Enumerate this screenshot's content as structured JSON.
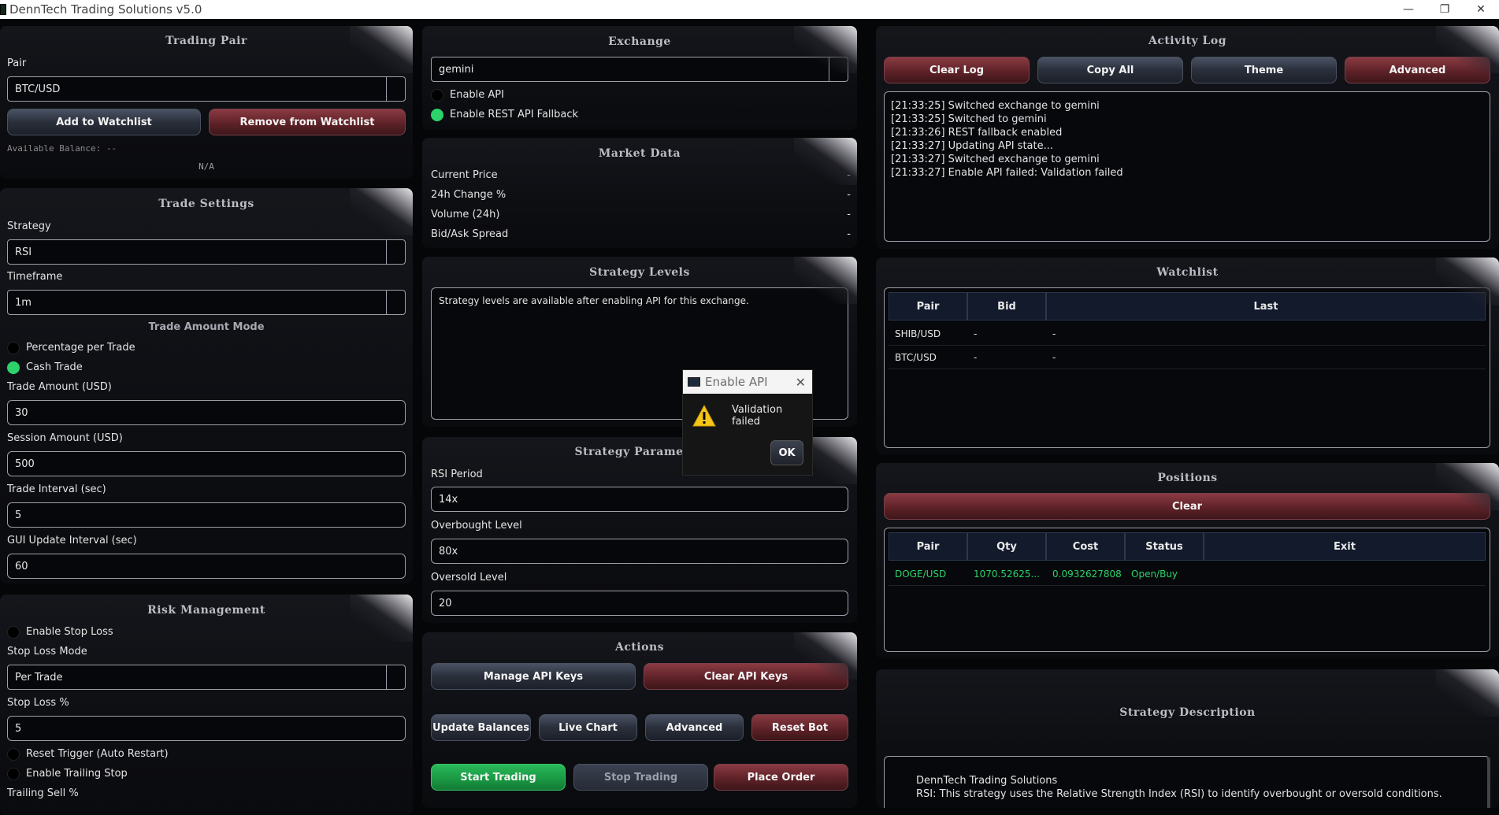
{
  "window": {
    "title": "DennTech Trading Solutions v5.0",
    "minimize": "—",
    "restore": "❐",
    "close": "✕"
  },
  "trading_pair": {
    "title": "Trading Pair",
    "pair_label": "Pair",
    "pair_value": "BTC/USD",
    "add_btn": "Add to Watchlist",
    "remove_btn": "Remove from Watchlist",
    "balance": "Available Balance: --",
    "balance_sub": "N/A"
  },
  "trade_settings": {
    "title": "Trade Settings",
    "strategy_label": "Strategy",
    "strategy_value": "RSI",
    "timeframe_label": "Timeframe",
    "timeframe_value": "1m",
    "mode_title": "Trade Amount Mode",
    "pct_label": "Percentage per Trade",
    "cash_label": "Cash Trade",
    "amount_label": "Trade Amount (USD)",
    "amount_value": "30",
    "session_label": "Session Amount (USD)",
    "session_value": "500",
    "interval_label": "Trade Interval (sec)",
    "interval_value": "5",
    "gui_label": "GUI Update Interval (sec)",
    "gui_value": "60"
  },
  "risk": {
    "title": "Risk Management",
    "stop_loss_label": "Enable Stop Loss",
    "mode_label": "Stop Loss Mode",
    "mode_value": "Per Trade",
    "pct_label": "Stop Loss %",
    "pct_value": "5",
    "reset_label": "Reset Trigger (Auto Restart)",
    "trailing_label": "Enable Trailing Stop",
    "trailing_sell_label": "Trailing Sell %"
  },
  "exchange": {
    "title": "Exchange",
    "value": "gemini",
    "api_label": "Enable API",
    "rest_label": "Enable REST API Fallback"
  },
  "market": {
    "title": "Market Data",
    "rows": [
      {
        "label": "Current Price",
        "value": "-"
      },
      {
        "label": "24h Change %",
        "value": "-"
      },
      {
        "label": "Volume (24h)",
        "value": "-"
      },
      {
        "label": "Bid/Ask Spread",
        "value": "-"
      }
    ]
  },
  "strategy_levels": {
    "title": "Strategy Levels",
    "text": "Strategy levels are available after enabling API for this exchange."
  },
  "strategy_params": {
    "title": "Strategy Paramet",
    "rsi_label": "RSI Period",
    "rsi_value": "14x",
    "ob_label": "Overbought Level",
    "ob_value": "80x",
    "os_label": "Oversold Level",
    "os_value": "20"
  },
  "actions": {
    "title": "Actions",
    "manage": "Manage API Keys",
    "clear": "Clear API Keys",
    "update": "Update Balances",
    "chart": "Live Chart",
    "advanced": "Advanced",
    "reset": "Reset Bot",
    "start": "Start Trading",
    "stop": "Stop Trading",
    "order": "Place Order"
  },
  "log": {
    "title": "Activity Log",
    "clear": "Clear Log",
    "copy": "Copy All",
    "theme": "Theme",
    "advanced": "Advanced",
    "lines": [
      "[21:33:25] Switched exchange to gemini",
      "[21:33:25] Switched to gemini",
      "[21:33:26] REST fallback enabled",
      "[21:33:27] Updating API state...",
      "[21:33:27] Switched exchange to gemini",
      "[21:33:27] Enable API failed: Validation failed"
    ]
  },
  "watchlist": {
    "title": "Watchlist",
    "headers": [
      "Pair",
      "Bid",
      "Last"
    ],
    "rows": [
      [
        "SHIB/USD",
        "-",
        "-"
      ],
      [
        "BTC/USD",
        "-",
        "-"
      ]
    ]
  },
  "positions": {
    "title": "Positions",
    "clear": "Clear",
    "headers": [
      "Pair",
      "Qty",
      "Cost",
      "Status",
      "Exit"
    ],
    "rows": [
      [
        "DOGE/USD",
        "1070.52625...",
        "0.0932627808",
        "Open/Buy",
        ""
      ]
    ]
  },
  "description": {
    "title": "Strategy Description",
    "line1": "DennTech Trading Solutions",
    "line2": "RSI: This strategy uses the Relative Strength Index (RSI) to identify overbought or oversold conditions."
  },
  "dialog": {
    "title": "Enable API",
    "message": "Validation failed",
    "ok": "OK"
  },
  "colors": {
    "green": "#2bd36a",
    "red_btn": "#5e2228",
    "slate_btn": "#2a2f3b",
    "position_text": "#2bd36a"
  }
}
